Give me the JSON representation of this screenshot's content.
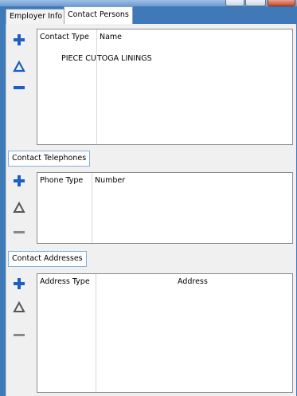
{
  "tabs": [
    {
      "label": "Employer Info",
      "active": false
    },
    {
      "label": "Contact Persons",
      "active": true
    }
  ],
  "contact_persons": {
    "columns": [
      "Contact Type",
      "Name"
    ],
    "rows": [
      {
        "contact_type": "PIECE CU",
        "name": "TOGA LININGS"
      }
    ]
  },
  "contact_telephones": {
    "label": "Contact Telephones",
    "columns": [
      "Phone Type",
      "Number"
    ],
    "rows": []
  },
  "contact_addresses": {
    "label": "Contact Addresses",
    "columns": [
      "Address Type",
      "Address"
    ],
    "rows": []
  },
  "icons": {
    "add": "plus-icon",
    "edit": "delta-edit-icon",
    "remove": "minus-icon"
  },
  "colors": {
    "accent_blue": "#1c5fc2",
    "window_blue": "#3f79b8",
    "panel": "#f0f0f0",
    "close_red": "#c64b33"
  }
}
